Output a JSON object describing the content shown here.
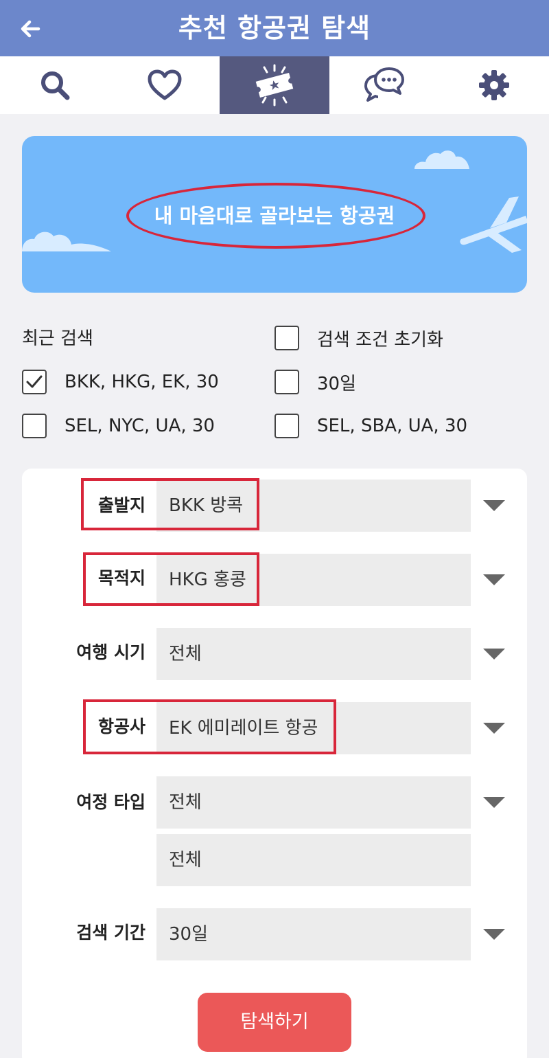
{
  "header": {
    "title": "추천 항공권 탐색"
  },
  "tabs": [
    {
      "icon": "search-icon"
    },
    {
      "icon": "heart-icon"
    },
    {
      "icon": "ticket-icon",
      "active": true
    },
    {
      "icon": "chat-icon"
    },
    {
      "icon": "gear-icon"
    }
  ],
  "banner": {
    "text": "내 마음대로 골라보는 항공권"
  },
  "recent": {
    "title": "최근 검색",
    "reset_label": "검색 조건 초기화",
    "items": [
      {
        "label": "BKK, HKG, EK, 30",
        "checked": true
      },
      {
        "label": "30일",
        "checked": false
      },
      {
        "label": "SEL, NYC, UA, 30",
        "checked": false
      },
      {
        "label": "SEL, SBA, UA, 30",
        "checked": false
      }
    ]
  },
  "form": {
    "departure": {
      "label": "출발지",
      "value": "BKK 방콕"
    },
    "destination": {
      "label": "목적지",
      "value": "HKG 홍콩"
    },
    "travel_time": {
      "label": "여행 시기",
      "value": "전체"
    },
    "airline": {
      "label": "항공사",
      "value": "EK 에미레이트 항공"
    },
    "trip_type": {
      "label": "여정 타입",
      "value": "전체",
      "value2": "전체"
    },
    "period": {
      "label": "검색 기간",
      "value": "30일"
    },
    "search_button": "탐색하기"
  },
  "colors": {
    "header": "#6c87cb",
    "active_tab": "#55597f",
    "banner": "#73b8fa",
    "button": "#eb5858",
    "highlight": "#d8263a"
  }
}
